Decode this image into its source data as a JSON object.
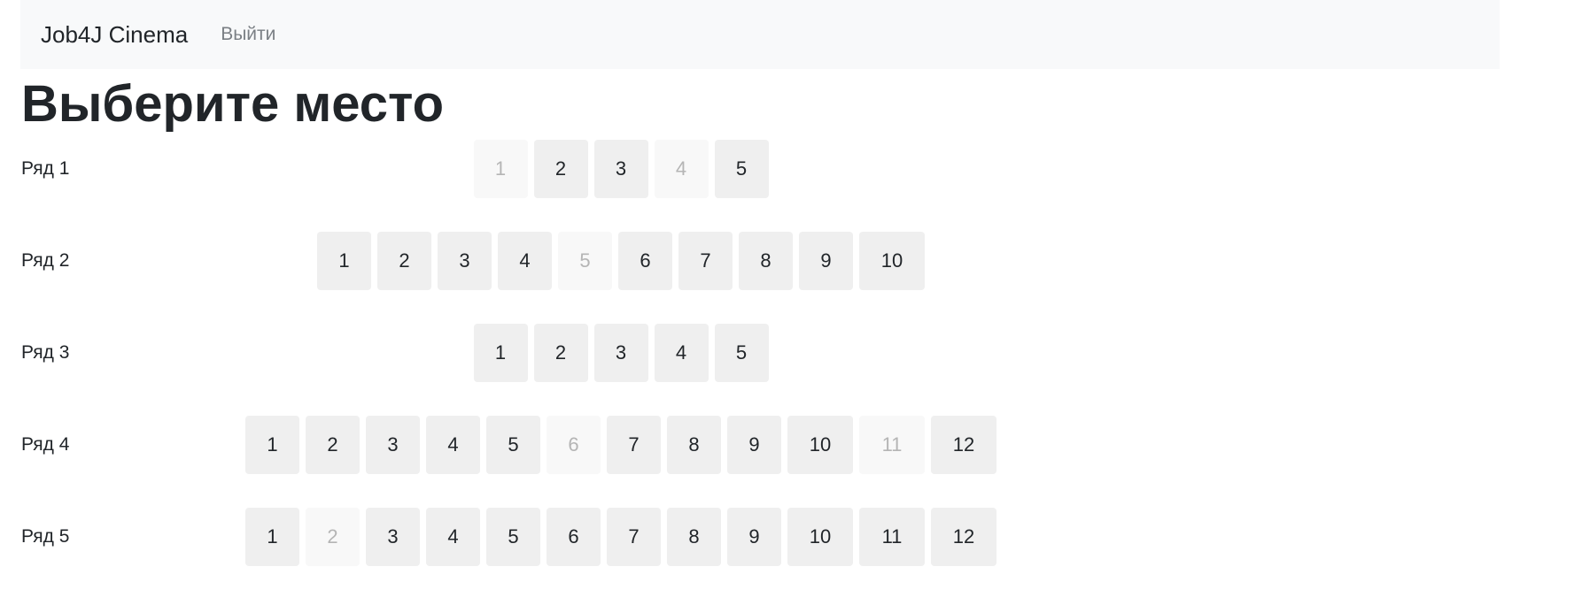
{
  "navbar": {
    "brand": "Job4J Cinema",
    "logout_label": "Выйти"
  },
  "page": {
    "title": "Выберите место"
  },
  "rows": [
    {
      "label": "Ряд 1",
      "seats": [
        {
          "number": "1",
          "available": false
        },
        {
          "number": "2",
          "available": true
        },
        {
          "number": "3",
          "available": true
        },
        {
          "number": "4",
          "available": false
        },
        {
          "number": "5",
          "available": true
        }
      ]
    },
    {
      "label": "Ряд 2",
      "seats": [
        {
          "number": "1",
          "available": true
        },
        {
          "number": "2",
          "available": true
        },
        {
          "number": "3",
          "available": true
        },
        {
          "number": "4",
          "available": true
        },
        {
          "number": "5",
          "available": false
        },
        {
          "number": "6",
          "available": true
        },
        {
          "number": "7",
          "available": true
        },
        {
          "number": "8",
          "available": true
        },
        {
          "number": "9",
          "available": true
        },
        {
          "number": "10",
          "available": true
        }
      ]
    },
    {
      "label": "Ряд 3",
      "seats": [
        {
          "number": "1",
          "available": true
        },
        {
          "number": "2",
          "available": true
        },
        {
          "number": "3",
          "available": true
        },
        {
          "number": "4",
          "available": true
        },
        {
          "number": "5",
          "available": true
        }
      ]
    },
    {
      "label": "Ряд 4",
      "seats": [
        {
          "number": "1",
          "available": true
        },
        {
          "number": "2",
          "available": true
        },
        {
          "number": "3",
          "available": true
        },
        {
          "number": "4",
          "available": true
        },
        {
          "number": "5",
          "available": true
        },
        {
          "number": "6",
          "available": false
        },
        {
          "number": "7",
          "available": true
        },
        {
          "number": "8",
          "available": true
        },
        {
          "number": "9",
          "available": true
        },
        {
          "number": "10",
          "available": true
        },
        {
          "number": "11",
          "available": false
        },
        {
          "number": "12",
          "available": true
        }
      ]
    },
    {
      "label": "Ряд 5",
      "seats": [
        {
          "number": "1",
          "available": true
        },
        {
          "number": "2",
          "available": false
        },
        {
          "number": "3",
          "available": true
        },
        {
          "number": "4",
          "available": true
        },
        {
          "number": "5",
          "available": true
        },
        {
          "number": "6",
          "available": true
        },
        {
          "number": "7",
          "available": true
        },
        {
          "number": "8",
          "available": true
        },
        {
          "number": "9",
          "available": true
        },
        {
          "number": "10",
          "available": true
        },
        {
          "number": "11",
          "available": true
        },
        {
          "number": "12",
          "available": true
        }
      ]
    }
  ]
}
